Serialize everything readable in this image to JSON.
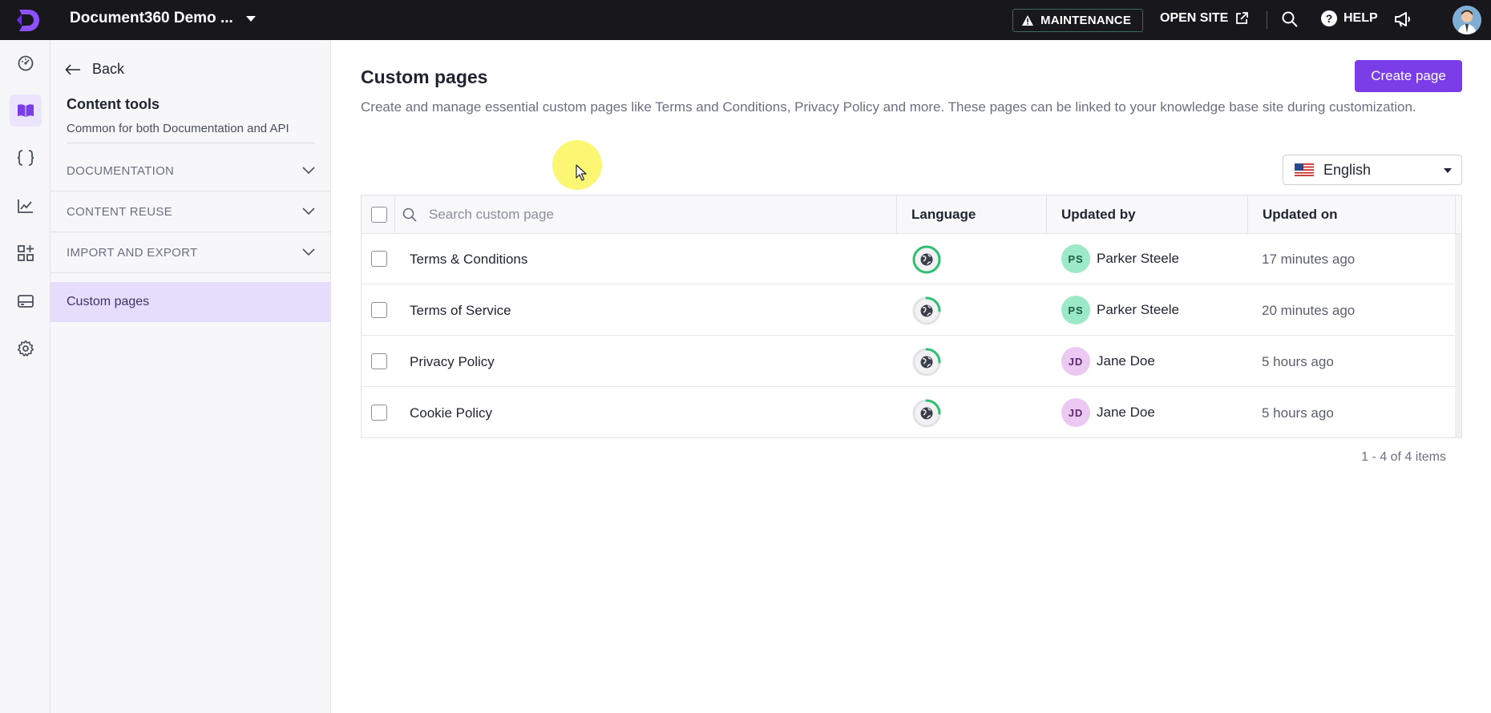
{
  "topbar": {
    "project_name": "Document360 Demo ...",
    "maintenance_label": "MAINTENANCE",
    "open_site_label": "OPEN SITE",
    "help_label": "HELP",
    "accent": "#7a3de8"
  },
  "rail": {
    "items": [
      "dashboard-icon",
      "documentation-icon",
      "api-icon",
      "analytics-icon",
      "apps-icon",
      "drive-icon",
      "settings-icon"
    ],
    "active": "documentation-icon"
  },
  "sidebar": {
    "back_label": "Back",
    "title": "Content tools",
    "subtitle": "Common for both Documentation and API",
    "sections": [
      {
        "label": "DOCUMENTATION"
      },
      {
        "label": "CONTENT REUSE"
      },
      {
        "label": "IMPORT AND EXPORT"
      }
    ],
    "active_item": "Custom pages"
  },
  "main": {
    "title": "Custom pages",
    "description": "Create and manage essential custom pages like Terms and Conditions, Privacy Policy and more. These pages can be linked to your knowledge base site during customization.",
    "create_button": "Create page",
    "language_select": "English",
    "search_placeholder": "Search custom page",
    "columns": {
      "language": "Language",
      "updated_by": "Updated by",
      "updated_on": "Updated on"
    },
    "rows": [
      {
        "name": "Terms & Conditions",
        "initials": "PS",
        "user": "Parker Steele",
        "updated": "17 minutes ago",
        "avatar_bg": "#9ce9c8",
        "avatar_fg": "#1c5a3f",
        "lang_progress": 1.0
      },
      {
        "name": "Terms of Service",
        "initials": "PS",
        "user": "Parker Steele",
        "updated": "20 minutes ago",
        "avatar_bg": "#9ce9c8",
        "avatar_fg": "#1c5a3f",
        "lang_progress": 0.25
      },
      {
        "name": "Privacy Policy",
        "initials": "JD",
        "user": "Jane Doe",
        "updated": "5 hours ago",
        "avatar_bg": "#ecc9f2",
        "avatar_fg": "#5e2a6a",
        "lang_progress": 0.25
      },
      {
        "name": "Cookie Policy",
        "initials": "JD",
        "user": "Jane Doe",
        "updated": "5 hours ago",
        "avatar_bg": "#ecc9f2",
        "avatar_fg": "#5e2a6a",
        "lang_progress": 0.25
      }
    ],
    "pager": "1 - 4 of 4 items"
  }
}
